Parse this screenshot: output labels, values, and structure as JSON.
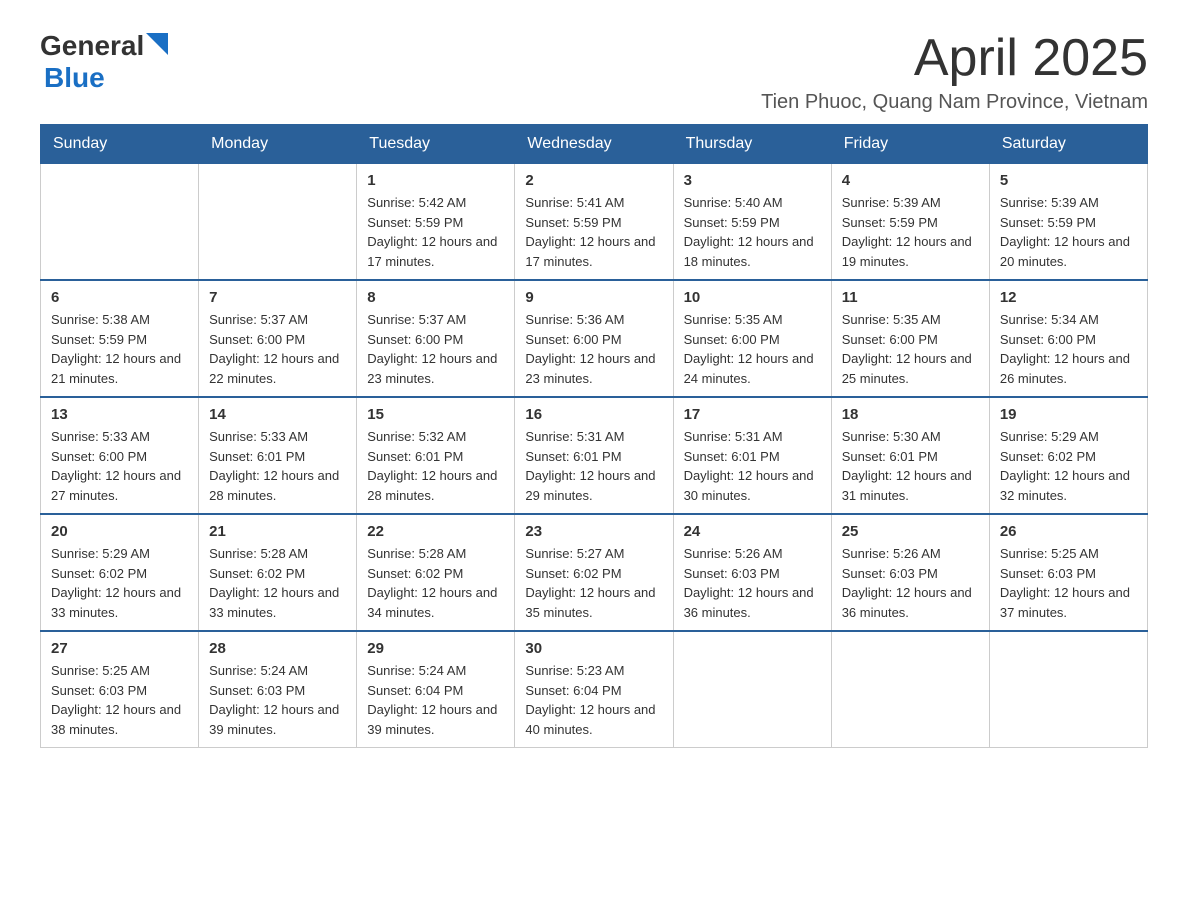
{
  "header": {
    "logo_general": "General",
    "logo_blue": "Blue",
    "month_year": "April 2025",
    "location": "Tien Phuoc, Quang Nam Province, Vietnam"
  },
  "days_of_week": [
    "Sunday",
    "Monday",
    "Tuesday",
    "Wednesday",
    "Thursday",
    "Friday",
    "Saturday"
  ],
  "weeks": [
    [
      {
        "day": "",
        "sunrise": "",
        "sunset": "",
        "daylight": ""
      },
      {
        "day": "",
        "sunrise": "",
        "sunset": "",
        "daylight": ""
      },
      {
        "day": "1",
        "sunrise": "Sunrise: 5:42 AM",
        "sunset": "Sunset: 5:59 PM",
        "daylight": "Daylight: 12 hours and 17 minutes."
      },
      {
        "day": "2",
        "sunrise": "Sunrise: 5:41 AM",
        "sunset": "Sunset: 5:59 PM",
        "daylight": "Daylight: 12 hours and 17 minutes."
      },
      {
        "day": "3",
        "sunrise": "Sunrise: 5:40 AM",
        "sunset": "Sunset: 5:59 PM",
        "daylight": "Daylight: 12 hours and 18 minutes."
      },
      {
        "day": "4",
        "sunrise": "Sunrise: 5:39 AM",
        "sunset": "Sunset: 5:59 PM",
        "daylight": "Daylight: 12 hours and 19 minutes."
      },
      {
        "day": "5",
        "sunrise": "Sunrise: 5:39 AM",
        "sunset": "Sunset: 5:59 PM",
        "daylight": "Daylight: 12 hours and 20 minutes."
      }
    ],
    [
      {
        "day": "6",
        "sunrise": "Sunrise: 5:38 AM",
        "sunset": "Sunset: 5:59 PM",
        "daylight": "Daylight: 12 hours and 21 minutes."
      },
      {
        "day": "7",
        "sunrise": "Sunrise: 5:37 AM",
        "sunset": "Sunset: 6:00 PM",
        "daylight": "Daylight: 12 hours and 22 minutes."
      },
      {
        "day": "8",
        "sunrise": "Sunrise: 5:37 AM",
        "sunset": "Sunset: 6:00 PM",
        "daylight": "Daylight: 12 hours and 23 minutes."
      },
      {
        "day": "9",
        "sunrise": "Sunrise: 5:36 AM",
        "sunset": "Sunset: 6:00 PM",
        "daylight": "Daylight: 12 hours and 23 minutes."
      },
      {
        "day": "10",
        "sunrise": "Sunrise: 5:35 AM",
        "sunset": "Sunset: 6:00 PM",
        "daylight": "Daylight: 12 hours and 24 minutes."
      },
      {
        "day": "11",
        "sunrise": "Sunrise: 5:35 AM",
        "sunset": "Sunset: 6:00 PM",
        "daylight": "Daylight: 12 hours and 25 minutes."
      },
      {
        "day": "12",
        "sunrise": "Sunrise: 5:34 AM",
        "sunset": "Sunset: 6:00 PM",
        "daylight": "Daylight: 12 hours and 26 minutes."
      }
    ],
    [
      {
        "day": "13",
        "sunrise": "Sunrise: 5:33 AM",
        "sunset": "Sunset: 6:00 PM",
        "daylight": "Daylight: 12 hours and 27 minutes."
      },
      {
        "day": "14",
        "sunrise": "Sunrise: 5:33 AM",
        "sunset": "Sunset: 6:01 PM",
        "daylight": "Daylight: 12 hours and 28 minutes."
      },
      {
        "day": "15",
        "sunrise": "Sunrise: 5:32 AM",
        "sunset": "Sunset: 6:01 PM",
        "daylight": "Daylight: 12 hours and 28 minutes."
      },
      {
        "day": "16",
        "sunrise": "Sunrise: 5:31 AM",
        "sunset": "Sunset: 6:01 PM",
        "daylight": "Daylight: 12 hours and 29 minutes."
      },
      {
        "day": "17",
        "sunrise": "Sunrise: 5:31 AM",
        "sunset": "Sunset: 6:01 PM",
        "daylight": "Daylight: 12 hours and 30 minutes."
      },
      {
        "day": "18",
        "sunrise": "Sunrise: 5:30 AM",
        "sunset": "Sunset: 6:01 PM",
        "daylight": "Daylight: 12 hours and 31 minutes."
      },
      {
        "day": "19",
        "sunrise": "Sunrise: 5:29 AM",
        "sunset": "Sunset: 6:02 PM",
        "daylight": "Daylight: 12 hours and 32 minutes."
      }
    ],
    [
      {
        "day": "20",
        "sunrise": "Sunrise: 5:29 AM",
        "sunset": "Sunset: 6:02 PM",
        "daylight": "Daylight: 12 hours and 33 minutes."
      },
      {
        "day": "21",
        "sunrise": "Sunrise: 5:28 AM",
        "sunset": "Sunset: 6:02 PM",
        "daylight": "Daylight: 12 hours and 33 minutes."
      },
      {
        "day": "22",
        "sunrise": "Sunrise: 5:28 AM",
        "sunset": "Sunset: 6:02 PM",
        "daylight": "Daylight: 12 hours and 34 minutes."
      },
      {
        "day": "23",
        "sunrise": "Sunrise: 5:27 AM",
        "sunset": "Sunset: 6:02 PM",
        "daylight": "Daylight: 12 hours and 35 minutes."
      },
      {
        "day": "24",
        "sunrise": "Sunrise: 5:26 AM",
        "sunset": "Sunset: 6:03 PM",
        "daylight": "Daylight: 12 hours and 36 minutes."
      },
      {
        "day": "25",
        "sunrise": "Sunrise: 5:26 AM",
        "sunset": "Sunset: 6:03 PM",
        "daylight": "Daylight: 12 hours and 36 minutes."
      },
      {
        "day": "26",
        "sunrise": "Sunrise: 5:25 AM",
        "sunset": "Sunset: 6:03 PM",
        "daylight": "Daylight: 12 hours and 37 minutes."
      }
    ],
    [
      {
        "day": "27",
        "sunrise": "Sunrise: 5:25 AM",
        "sunset": "Sunset: 6:03 PM",
        "daylight": "Daylight: 12 hours and 38 minutes."
      },
      {
        "day": "28",
        "sunrise": "Sunrise: 5:24 AM",
        "sunset": "Sunset: 6:03 PM",
        "daylight": "Daylight: 12 hours and 39 minutes."
      },
      {
        "day": "29",
        "sunrise": "Sunrise: 5:24 AM",
        "sunset": "Sunset: 6:04 PM",
        "daylight": "Daylight: 12 hours and 39 minutes."
      },
      {
        "day": "30",
        "sunrise": "Sunrise: 5:23 AM",
        "sunset": "Sunset: 6:04 PM",
        "daylight": "Daylight: 12 hours and 40 minutes."
      },
      {
        "day": "",
        "sunrise": "",
        "sunset": "",
        "daylight": ""
      },
      {
        "day": "",
        "sunrise": "",
        "sunset": "",
        "daylight": ""
      },
      {
        "day": "",
        "sunrise": "",
        "sunset": "",
        "daylight": ""
      }
    ]
  ]
}
